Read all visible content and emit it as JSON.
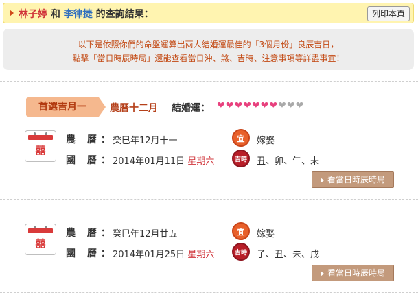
{
  "header": {
    "name1": "林子婷",
    "conj": "和",
    "name2": "李律捷",
    "suffix": "的查詢結果：",
    "print_label": "列印本頁"
  },
  "notice": {
    "line1": "以下是依照你們的命盤運算出兩人結婚運最佳的「3個月份」良辰吉日，",
    "line2": "點擊「當日時辰時局」還能查看當日沖、煞、吉時、注意事項等詳盡事宜！"
  },
  "section": {
    "tag": "首選吉月一",
    "month": "農曆十二月",
    "fortune_label": "結婚運：",
    "hearts_on": 7,
    "hearts_total": 10
  },
  "labels": {
    "lunar": "農 曆：",
    "solar": "國 曆："
  },
  "days": [
    {
      "lunar": "癸巳年12月十一",
      "solar_date": "2014年01月11日",
      "weekday": "星期六",
      "yi_icon": "宜",
      "activity": "嫁娶",
      "shi_icon": "吉時",
      "times": "丑、卯、午、未",
      "button": "看當日時辰時局"
    },
    {
      "lunar": "癸巳年12月廿五",
      "solar_date": "2014年01月25日",
      "weekday": "星期六",
      "yi_icon": "宜",
      "activity": "嫁娶",
      "shi_icon": "吉時",
      "times": "子、丑、未、戌",
      "button": "看當日時辰時局"
    }
  ],
  "icons": {
    "calendar": "囍",
    "heart": "❤"
  },
  "colors": {
    "header_bg": "#fff4b0",
    "accent_orange": "#b5401a",
    "heart_on": "#e8417e",
    "heart_off": "#aaaaaa",
    "button_bg": "#c39a7c"
  }
}
